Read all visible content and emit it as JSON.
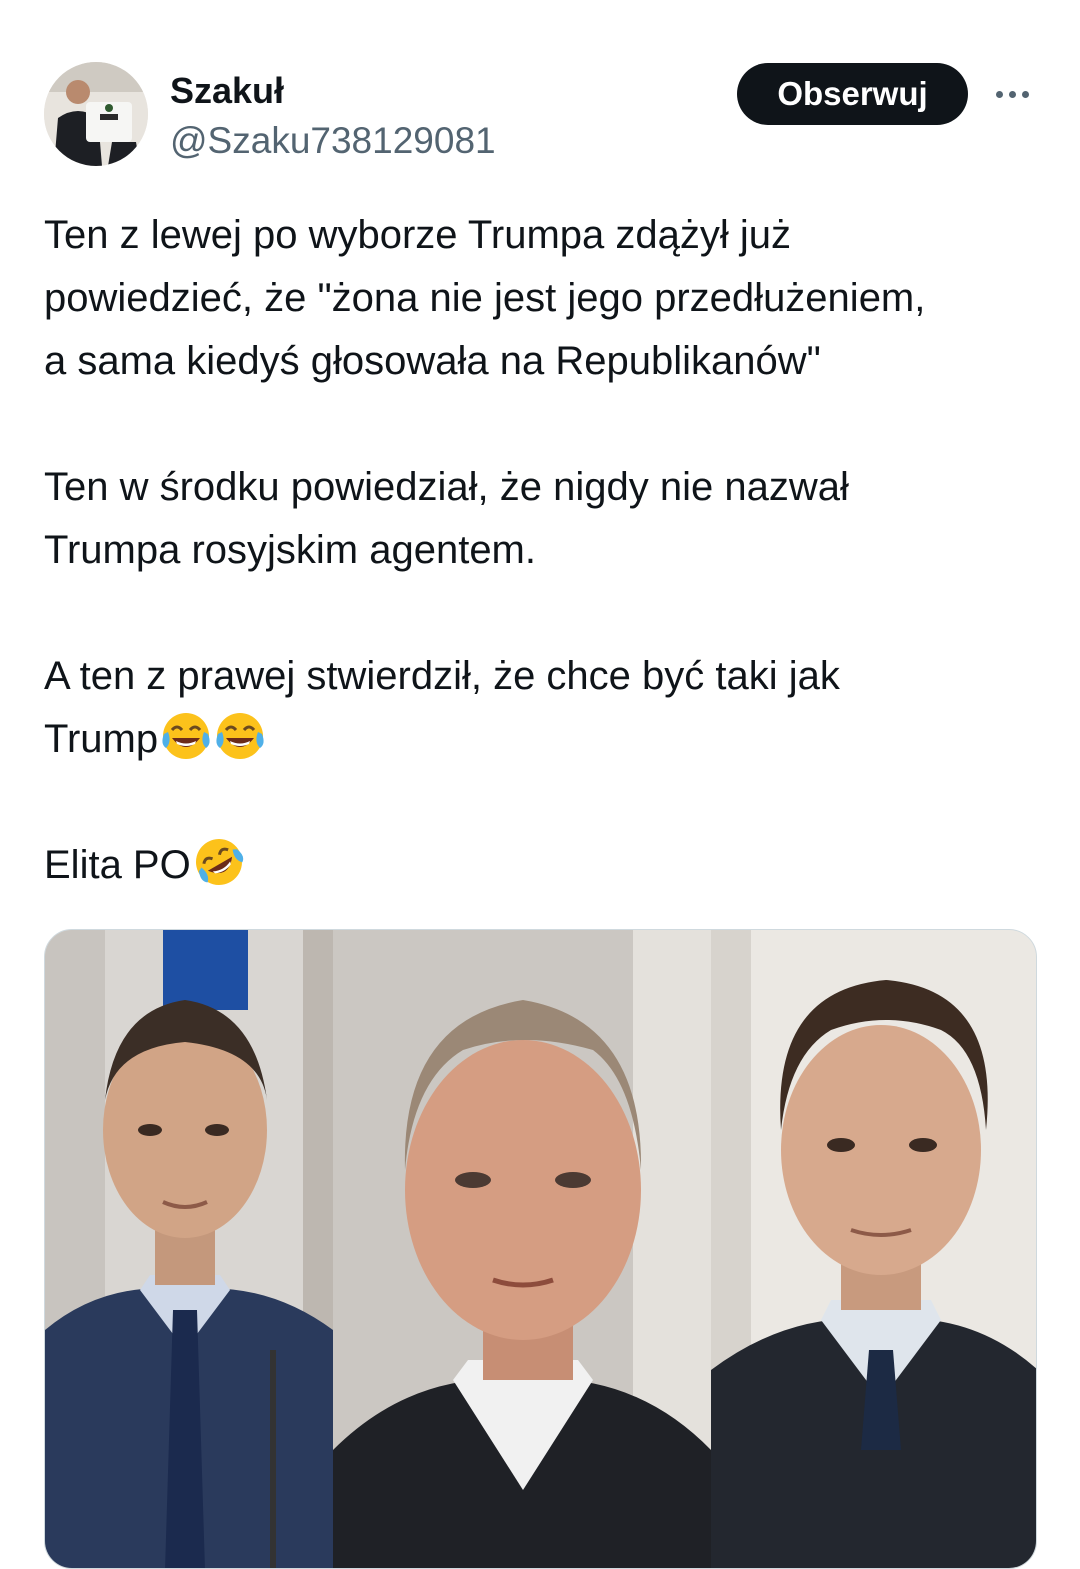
{
  "author": {
    "display_name": "Szakuł",
    "handle": "@Szaku738129081"
  },
  "actions": {
    "follow_label": "Obserwuj",
    "more_icon": "more-horizontal-icon"
  },
  "tweet": {
    "paragraphs": [
      {
        "text": "Ten z lewej po wyborze Trumpa zdążył już\npowiedzieć, że \"żona nie jest jego przedłużeniem,\na sama kiedyś głosowała na Republikanów\"",
        "emojis": []
      },
      {
        "text": "Ten w środku powiedział, że nigdy nie nazwał\nTrumpa rosyjskim agentem.",
        "emojis": []
      },
      {
        "text": "A ten z prawej stwierdził, że chce być taki jak\nTrump",
        "emojis": [
          "face-with-tears-of-joy",
          "face-with-tears-of-joy"
        ]
      },
      {
        "text": "Elita PO",
        "emojis": [
          "rolling-on-the-floor-laughing"
        ]
      }
    ]
  },
  "media": {
    "type": "photo-collage",
    "panels": 3
  },
  "colors": {
    "text": "#0f1419",
    "secondary_text": "#536471",
    "follow_button_bg": "#0f1419",
    "follow_button_text": "#ffffff",
    "media_border": "#cfd9de"
  }
}
